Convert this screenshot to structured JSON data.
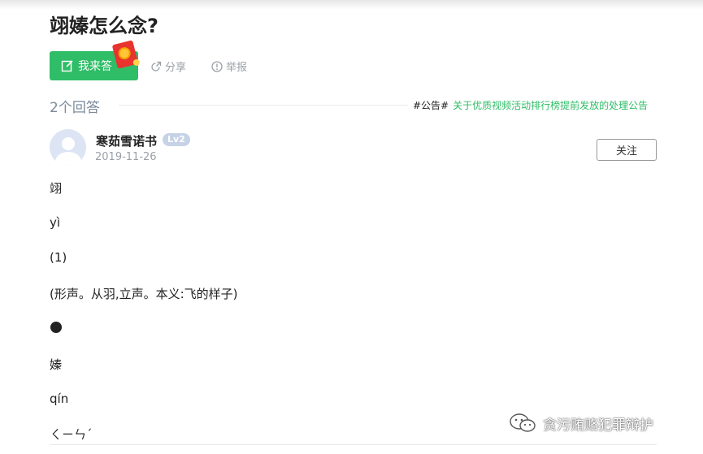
{
  "question": {
    "title": "翊嫀怎么念?",
    "answer_button": "我来答",
    "share": "分享",
    "report": "举报"
  },
  "answers_header": {
    "count": "2个回答",
    "announcement_tag": "#公告#",
    "announcement_link": "关于优质视频活动排行榜提前发放的处理公告"
  },
  "answer": {
    "username": "寒茹雪诺书",
    "level": "Lv2",
    "date": "2019-11-26",
    "follow_button": "关注",
    "lines": [
      "翊",
      "yì",
      "(1)",
      "(形声。从羽,立声。本义:飞的样子)",
      "嫀",
      "qín",
      "ㄑㄧㄣˊ"
    ]
  },
  "watermark": {
    "text": "贪污贿赂犯罪辩护"
  },
  "colors": {
    "accent": "#2fbd67",
    "muted": "#9aa0a6",
    "level_badge": "#c6d3e6"
  },
  "icons": [
    "edit-icon",
    "red-packet-icon",
    "share-icon",
    "report-icon",
    "avatar-icon",
    "wechat-icon"
  ]
}
